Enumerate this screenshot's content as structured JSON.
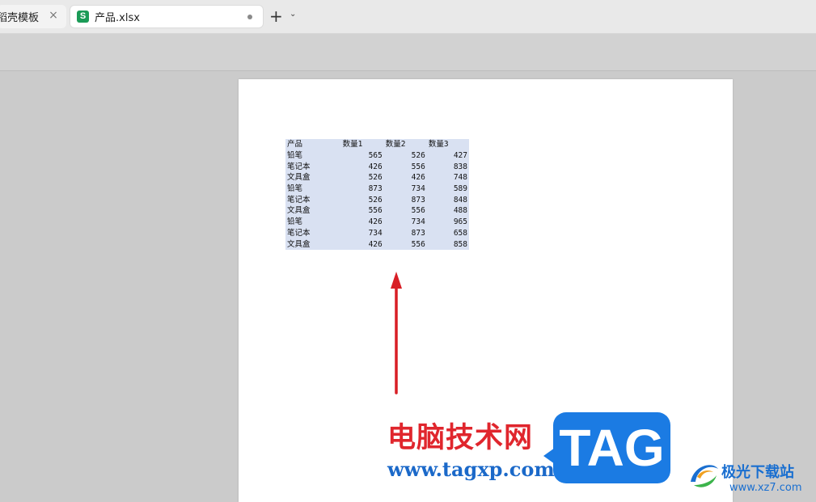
{
  "tabs": [
    {
      "label": "稻壳模板",
      "active": false
    },
    {
      "label": "产品.xlsx",
      "active": true,
      "icon_letter": "S"
    }
  ],
  "new_tab_symbol": "+",
  "new_tab_menu_symbol": "⌄",
  "table": {
    "headers": [
      "产品",
      "数量1",
      "数量2",
      "数量3"
    ],
    "rows": [
      [
        "铅笔",
        "565",
        "526",
        "427"
      ],
      [
        "笔记本",
        "426",
        "556",
        "838"
      ],
      [
        "文具盒",
        "526",
        "426",
        "748"
      ],
      [
        "铅笔",
        "873",
        "734",
        "589"
      ],
      [
        "笔记本",
        "526",
        "873",
        "848"
      ],
      [
        "文具盒",
        "556",
        "556",
        "488"
      ],
      [
        "铅笔",
        "426",
        "734",
        "965"
      ],
      [
        "笔记本",
        "734",
        "873",
        "658"
      ],
      [
        "文具盒",
        "426",
        "556",
        "858"
      ]
    ]
  },
  "watermark": {
    "site_name": "电脑技术网",
    "site_url": "www.tagxp.com",
    "tag_text": "TAG",
    "logo2_name": "极光下载站",
    "logo2_url": "www.xz7.com"
  },
  "colors": {
    "table_bg": "#d9e1f2",
    "arrow": "#d81e25",
    "tag_blue": "#1b7be3",
    "watermark_red": "#e0262d",
    "sheet_icon_green": "#1b9b57"
  }
}
